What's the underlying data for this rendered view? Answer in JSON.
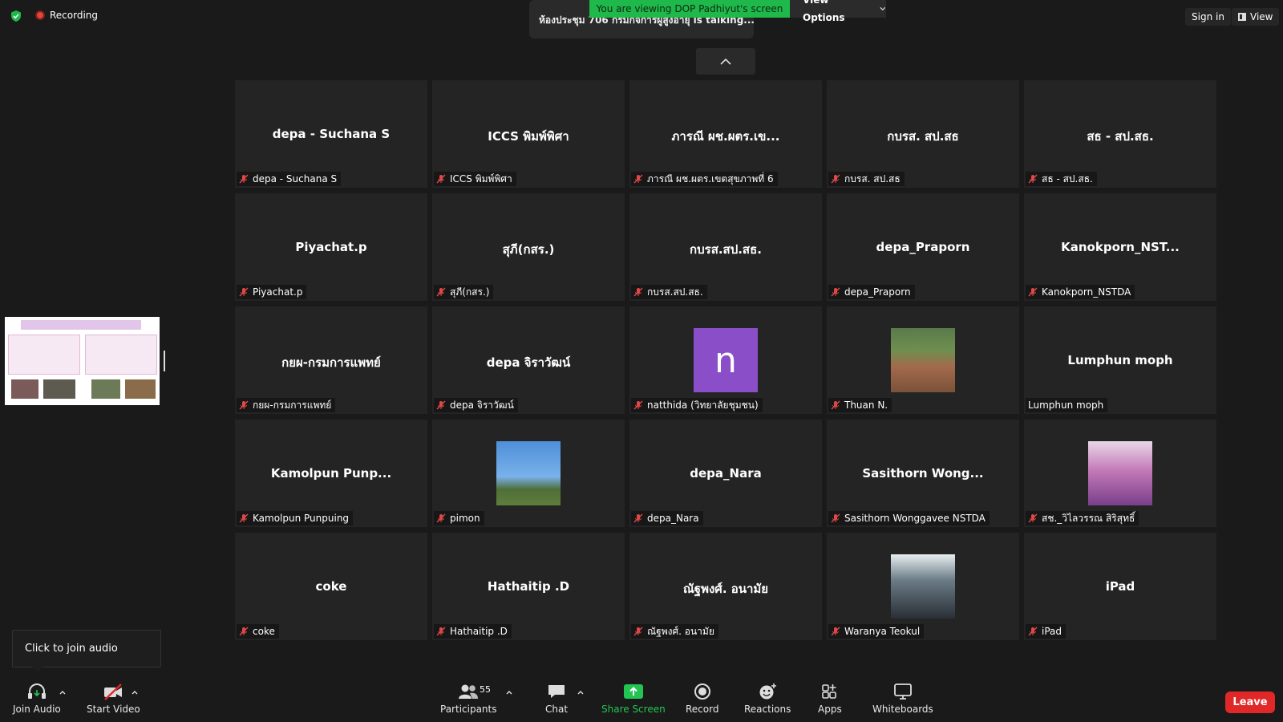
{
  "top": {
    "recording_label": "Recording",
    "talking_text": "ห้องประชุม 706 กรมกิจการผู้สูงอายุ is talking...",
    "viewing_banner": "You are viewing DOP Padhiyut's screen",
    "view_options_label": "View Options",
    "sign_in_label": "Sign in",
    "view_label": "View"
  },
  "tiles": [
    {
      "big": "depa - Suchana S",
      "name": "depa - Suchana S",
      "muted": true
    },
    {
      "big": "ICCS พิมพ์พิศา",
      "name": "ICCS พิมพ์พิศา",
      "muted": true
    },
    {
      "big": "ภารณี ผช.ผตร.เข...",
      "name": "ภารณี ผช.ผตร.เขตสุขภาพที่ 6",
      "muted": true
    },
    {
      "big": "กบรส. สป.สธ",
      "name": "กบรส. สป.สธ",
      "muted": true
    },
    {
      "big": "สธ - สป.สธ.",
      "name": "สธ - สป.สธ.",
      "muted": true
    },
    {
      "big": "Piyachat.p",
      "name": "Piyachat.p",
      "muted": true
    },
    {
      "big": "สุภี(กสร.)",
      "name": "สุภี(กสร.)",
      "muted": true
    },
    {
      "big": "กบรส.สป.สธ.",
      "name": "กบรส.สป.สธ.",
      "muted": true
    },
    {
      "big": "depa_Praporn",
      "name": "depa_Praporn",
      "muted": true
    },
    {
      "big": "Kanokporn_NST...",
      "name": "Kanokporn_NSTDA",
      "muted": true
    },
    {
      "big": "กยผ-กรมการแพทย์",
      "name": "กยผ-กรมการแพทย์",
      "muted": true
    },
    {
      "big": "depa จิราวัฒน์",
      "name": "depa จิราวัฒน์",
      "muted": true
    },
    {
      "big": "",
      "name": "natthida (วิทยาลัยชุมชน)",
      "muted": true,
      "avatar": "letter",
      "letter": "n"
    },
    {
      "big": "",
      "name": "Thuan N.",
      "muted": true,
      "avatar": "photo-landscape"
    },
    {
      "big": "Lumphun moph",
      "name": "Lumphun moph",
      "muted": false
    },
    {
      "big": "Kamolpun  Punp...",
      "name": "Kamolpun Punpuing",
      "muted": true
    },
    {
      "big": "",
      "name": "pimon",
      "muted": true,
      "avatar": "photo-sky"
    },
    {
      "big": "depa_Nara",
      "name": "depa_Nara",
      "muted": true
    },
    {
      "big": "Sasithorn  Wong...",
      "name": "Sasithorn Wonggavee NSTDA",
      "muted": true
    },
    {
      "big": "",
      "name": "สช._วิไลวรรณ  สิริสุทธิ์",
      "muted": true,
      "avatar": "photo-portrait"
    },
    {
      "big": "coke",
      "name": "coke",
      "muted": true
    },
    {
      "big": "Hathaitip .D",
      "name": "Hathaitip .D",
      "muted": true
    },
    {
      "big": "ณัฐพงศ์. อนามัย",
      "name": "ณัฐพงศ์. อนามัย",
      "muted": true
    },
    {
      "big": "",
      "name": "Waranya Teokul",
      "muted": true,
      "avatar": "photo-character"
    },
    {
      "big": "iPad",
      "name": "iPad",
      "muted": true
    }
  ],
  "tooltip": "Click to join audio",
  "toolbar": {
    "join_audio": "Join Audio",
    "start_video": "Start Video",
    "participants": "Participants",
    "participants_count": "55",
    "chat": "Chat",
    "share_screen": "Share Screen",
    "record": "Record",
    "reactions": "Reactions",
    "apps": "Apps",
    "whiteboards": "Whiteboards",
    "leave": "Leave"
  },
  "colors": {
    "share_green": "#23c552",
    "leave_red": "#e02828",
    "avatar_purple": "#8a4ec8"
  }
}
